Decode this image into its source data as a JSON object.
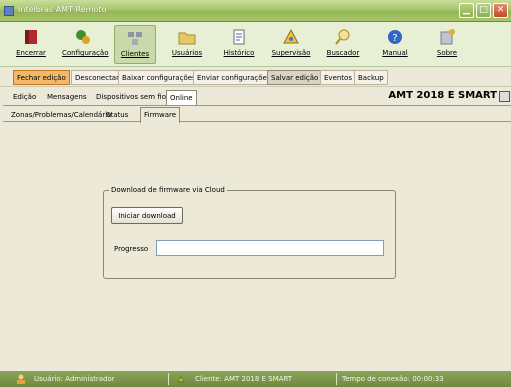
{
  "window": {
    "title": "Intelbras AMT Remoto",
    "buttons": [
      "minimize",
      "maximize",
      "close"
    ]
  },
  "toolbar": {
    "items": [
      {
        "label": "Encerrar",
        "icon": "book-icon"
      },
      {
        "label": "Configuração",
        "icon": "configuration-icon"
      },
      {
        "label": "Clientes",
        "icon": "clients-icon"
      },
      {
        "label": "Usuários",
        "icon": "users-folder-icon"
      },
      {
        "label": "Histórico",
        "icon": "history-icon"
      },
      {
        "label": "Supervisão",
        "icon": "supervision-icon"
      },
      {
        "label": "Buscador",
        "icon": "search-icon"
      },
      {
        "label": "Manual",
        "icon": "help-icon"
      },
      {
        "label": "Sobre",
        "icon": "about-icon"
      }
    ],
    "active": "Clientes"
  },
  "actions": {
    "items": [
      "Fechar edição",
      "Desconectar",
      "Baixar configurações",
      "Enviar configurações",
      "Salvar edição",
      "Eventos",
      "Backup"
    ]
  },
  "subtabs": {
    "items": [
      "Edição",
      "Mensagens",
      "Dispositivos sem fio",
      "Online"
    ],
    "selected": "Online"
  },
  "device_title": "AMT 2018 E SMART",
  "panel_tabs": {
    "items": [
      "Zonas/Problemas/Calendário",
      "Status",
      "Firmware"
    ],
    "selected": "Firmware"
  },
  "firmware": {
    "group_title": "Download de firmware via Cloud",
    "download_button": "Iniciar download",
    "progress_label": "Progresso",
    "progress": 0
  },
  "status": {
    "user": "Usuário: Administrador",
    "client": "Cliente: AMT 2018 E SMART",
    "connection_time": "Tempo de conexão: 00:00:33"
  },
  "colors": {
    "titlebar": "#a8c66c",
    "statusbar": "#7a954a",
    "highlight_button": "#f3b96b",
    "progress_fill": "#4fb04a"
  }
}
